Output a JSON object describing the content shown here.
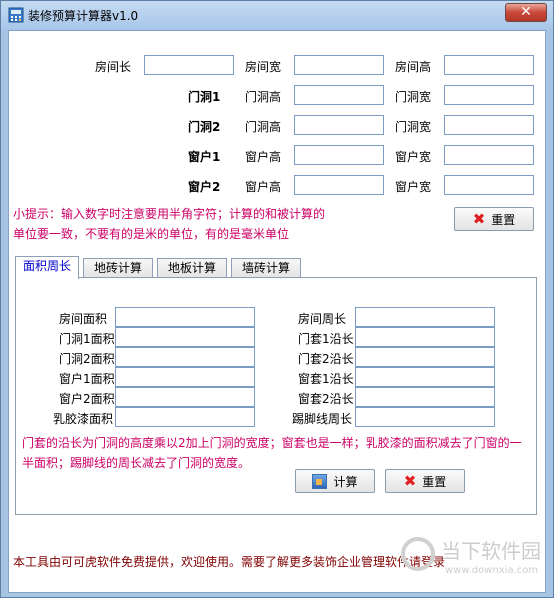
{
  "window": {
    "title": "装修预算计算器v1.0",
    "close_label": "✕"
  },
  "room": {
    "length_label": "房间长",
    "width_label": "房间宽",
    "height_label": "房间高"
  },
  "door1": {
    "label": "门洞1",
    "height_label": "门洞高",
    "width_label": "门洞宽"
  },
  "door2": {
    "label": "门洞2",
    "height_label": "门洞高",
    "width_label": "门洞宽"
  },
  "win1": {
    "label": "窗户1",
    "height_label": "窗户高",
    "width_label": "窗户宽"
  },
  "win2": {
    "label": "窗户2",
    "height_label": "窗户高",
    "width_label": "窗户宽"
  },
  "hint": {
    "line1": "小提示：输入数字时注意要用半角字符；计算的和被计算的",
    "line2": "单位要一致，不要有的是米的单位，有的是毫米单位"
  },
  "reset_top": {
    "label": "重置"
  },
  "tabs": [
    "面积周长",
    "地砖计算",
    "地板计算",
    "墙砖计算"
  ],
  "area": {
    "left": [
      "房间面积",
      "门洞1面积",
      "门洞2面积",
      "窗户1面积",
      "窗户2面积",
      "乳胶漆面积"
    ],
    "right": [
      "房间周长",
      "门套1沿长",
      "门套2沿长",
      "窗套1沿长",
      "窗套2沿长",
      "踢脚线周长"
    ],
    "note1": "门套的沿长为门洞的高度乘以2加上门洞的宽度；窗套也是一样；乳胶漆的面积减去了门窗的一",
    "note2": "半面积；踢脚线的周长减去了门洞的宽度。",
    "calc_label": "计算",
    "reset_label": "重置"
  },
  "footer": {
    "text": "本工具由可可虎软件免费提供，欢迎使用。需要了解更多装饰企业管理软件请登录"
  },
  "watermark": {
    "brand": "当下软件园",
    "url": "www.downxia.com"
  }
}
